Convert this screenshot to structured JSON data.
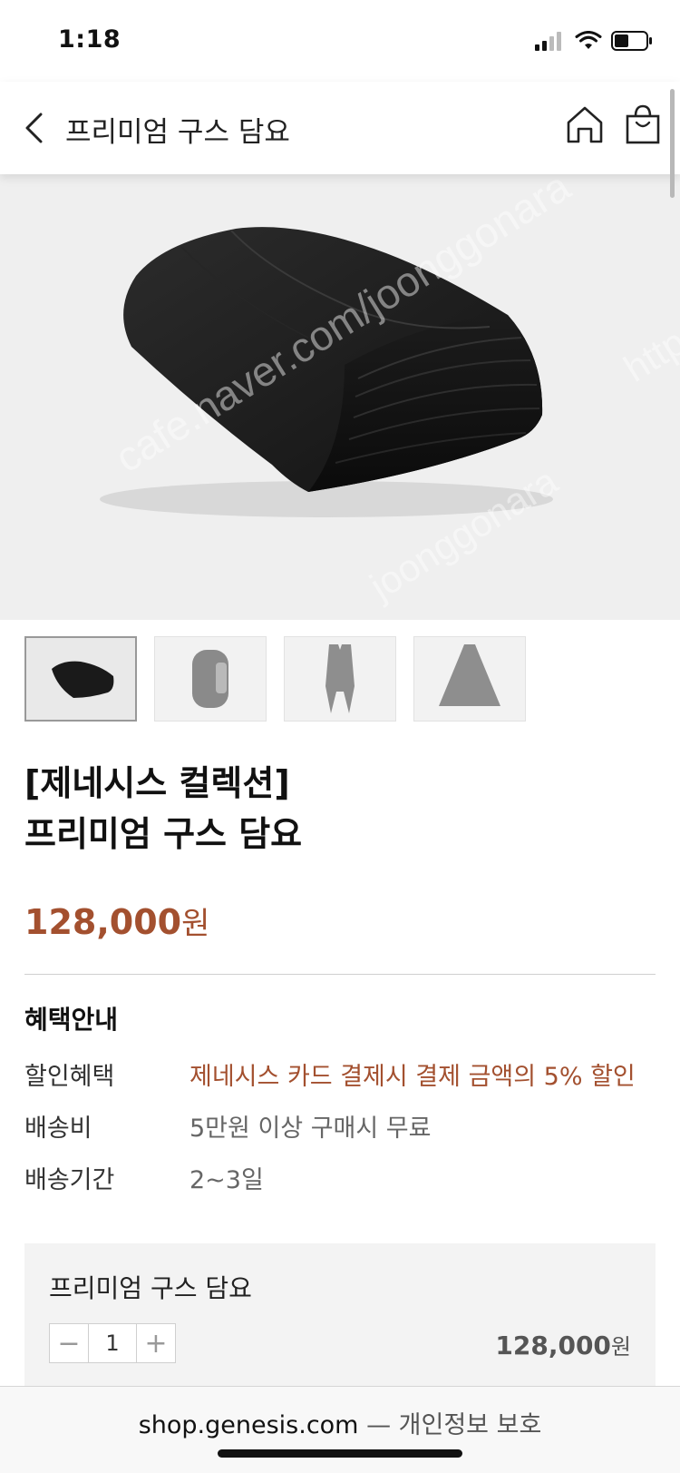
{
  "status_bar": {
    "time": "1:18"
  },
  "nav": {
    "title": "프리미엄 구스 담요"
  },
  "watermarks": [
    "cafe.naver.com/joonggonara",
    "joonggonara",
    "http"
  ],
  "product": {
    "title_line1": "[제네시스 컬렉션]",
    "title_line2": "프리미엄 구스 담요",
    "price": "128,000",
    "price_unit": "원"
  },
  "benefits": {
    "heading": "혜택안내",
    "rows": [
      {
        "label": "할인혜택",
        "value": "제네시스 카드 결제시 결제 금액의 5% 할인"
      },
      {
        "label": "배송비",
        "value": "5만원 이상 구매시 무료"
      },
      {
        "label": "배송기간",
        "value": "2~3일"
      }
    ]
  },
  "option": {
    "name": "프리미엄 구스 담요",
    "minus": "−",
    "quantity": "1",
    "plus": "+",
    "price": "128,000",
    "price_unit": "원"
  },
  "browser": {
    "domain": "shop.genesis.com",
    "security": "— 개인정보 보호"
  },
  "colors": {
    "accent": "#a3502f",
    "hero_bg": "#efefef",
    "text": "#111111"
  }
}
